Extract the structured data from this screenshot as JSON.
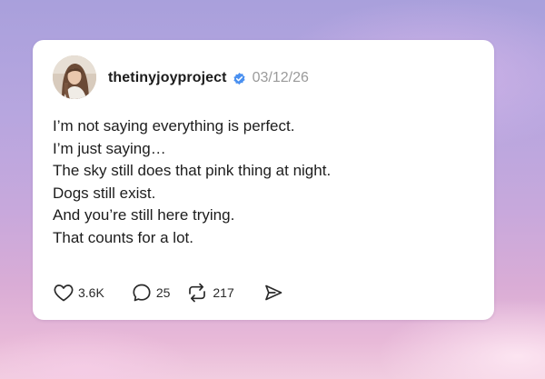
{
  "post": {
    "author": {
      "username": "thetinyjoyproject",
      "verified": true
    },
    "date": "03/12/26",
    "lines": [
      "I’m not saying everything is perfect.",
      "I’m just saying…",
      "The sky still does that pink thing at night.",
      "Dogs still exist.",
      "And you’re still here trying.",
      "That counts for a lot."
    ],
    "actions": {
      "likes": "3.6K",
      "replies": "25",
      "reposts": "217"
    }
  },
  "icons": {
    "like": "heart-icon",
    "reply": "speech-bubble-icon",
    "repost": "repost-arrows-icon",
    "share": "send-arrow-icon",
    "verified": "verified-badge-icon"
  },
  "colors": {
    "verified": "#4a90f0",
    "text": "#1d1d1d",
    "muted": "#9a9a9a"
  }
}
